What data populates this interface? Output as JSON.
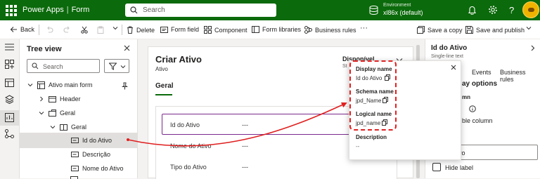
{
  "topbar": {
    "app_name": "Power Apps",
    "separator": "|",
    "page_name": "Form",
    "search_placeholder": "Search",
    "environment_label": "Environment",
    "environment_value": "xl86x (default)",
    "colors": {
      "background": "#0b6a0b",
      "text": "#ffffff"
    },
    "icons": [
      "waffle-icon",
      "search-icon",
      "environment-icon",
      "bell-icon",
      "gear-icon",
      "help-icon",
      "avatar"
    ]
  },
  "commandbar": {
    "back": "Back",
    "delete": "Delete",
    "form_field": "Form field",
    "component": "Component",
    "form_libraries": "Form libraries",
    "business_rules": "Business rules",
    "more": "···",
    "save_copy": "Save a copy",
    "save_publish": "Save and publish"
  },
  "tree": {
    "title": "Tree view",
    "search_placeholder": "Search",
    "items": [
      {
        "label": "Ativo main form",
        "level": 0,
        "expanded": true
      },
      {
        "label": "Header",
        "level": 1,
        "expanded": false
      },
      {
        "label": "Geral",
        "level": 1,
        "expanded": true
      },
      {
        "label": "Geral",
        "level": 2,
        "expanded": true
      },
      {
        "label": "Id do Ativo",
        "level": 3,
        "selected": true
      },
      {
        "label": "Descrição",
        "level": 3
      },
      {
        "label": "Nome do Ativo",
        "level": 3
      }
    ]
  },
  "form": {
    "title": "Criar Ativo",
    "subtitle": "Ativo",
    "status": "Disponível",
    "status_sub": "St",
    "tab": "Geral",
    "fields": [
      {
        "label": "Id do Ativo",
        "value": "---"
      },
      {
        "label": "Nome do Ativo",
        "value": "---"
      },
      {
        "label": "Tipo do Ativo",
        "value": "---"
      }
    ]
  },
  "right_panel": {
    "title": "Id do Ativo",
    "subtitle": "Single-line text",
    "tabs": [
      "Events",
      "Business rules"
    ],
    "display_options": "ay options",
    "column_partial": "mn",
    "required_column": "ble column",
    "input_partial": "vo",
    "hide_label": "Hide label"
  },
  "popup": {
    "display_name_label": "Display name",
    "display_name_value": "Id do Ativo",
    "schema_name_label": "Schema name",
    "schema_name_value": "jpd_Name",
    "logical_name_label": "Logical name",
    "logical_name_value": "jpd_name",
    "description_label": "Description",
    "description_value": "--"
  }
}
